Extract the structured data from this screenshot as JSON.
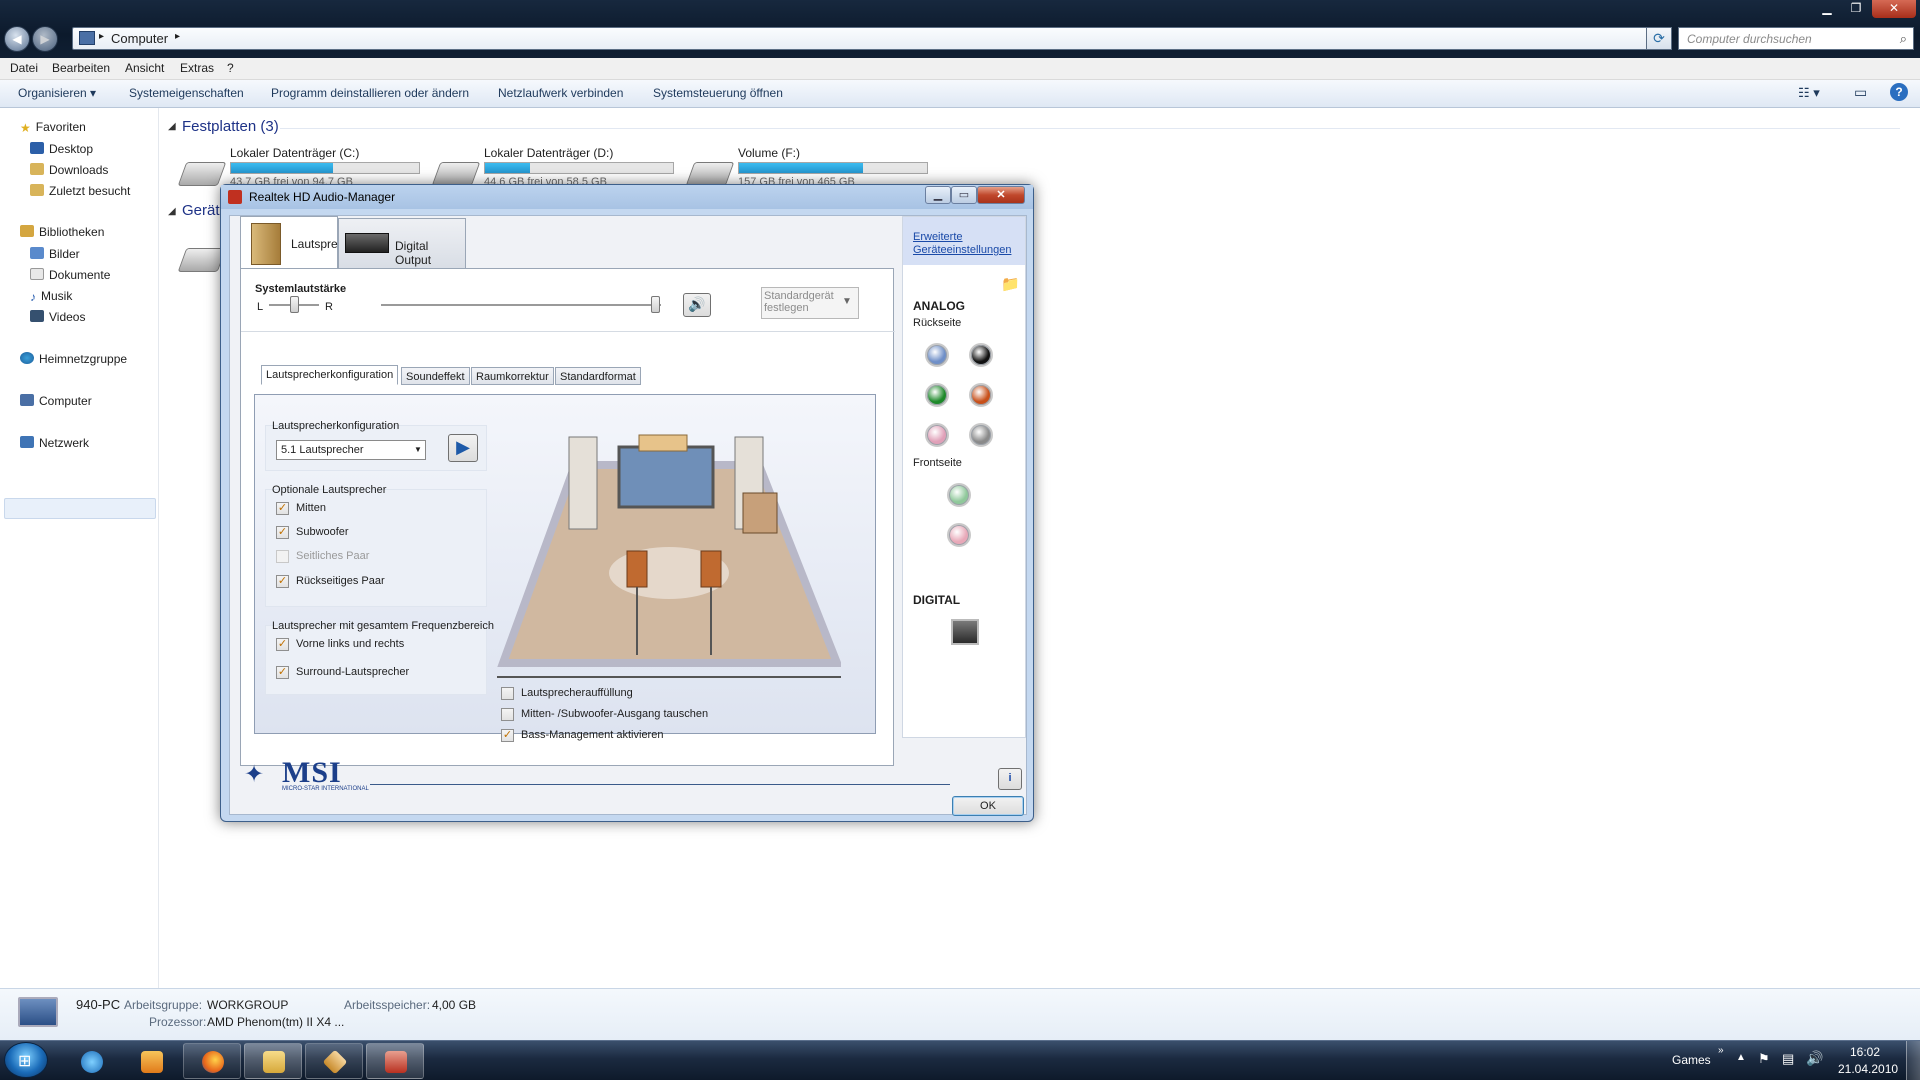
{
  "explorer": {
    "breadcrumb": "Computer",
    "search_placeholder": "Computer durchsuchen",
    "menu": [
      "Datei",
      "Bearbeiten",
      "Ansicht",
      "Extras",
      "?"
    ],
    "commands": [
      "Organisieren ▾",
      "Systemeigenschaften",
      "Programm deinstallieren oder ändern",
      "Netzlaufwerk verbinden",
      "Systemsteuerung öffnen"
    ],
    "nav": {
      "favorites": "Favoriten",
      "fav_items": [
        "Desktop",
        "Downloads",
        "Zuletzt besucht"
      ],
      "libraries": "Bibliotheken",
      "lib_items": [
        "Bilder",
        "Dokumente",
        "Musik",
        "Videos"
      ],
      "homegroup": "Heimnetzgruppe",
      "computer": "Computer",
      "network": "Netzwerk"
    },
    "group_disks": "Festplatten (3)",
    "group_devices": "Geräte",
    "drives": [
      {
        "name": "Lokaler Datenträger (C:)",
        "info": "43,7 GB frei von 94,7 GB",
        "used_fraction": 0.54
      },
      {
        "name": "Lokaler Datenträger (D:)",
        "info": "44,6 GB frei von 58,5 GB",
        "used_fraction": 0.24
      },
      {
        "name": "Volume (F:)",
        "info": "157 GB frei von 465 GB",
        "used_fraction": 0.66
      }
    ],
    "details": {
      "pc_name": "940-PC",
      "workgroup_label": "Arbeitsgruppe:",
      "workgroup": "WORKGROUP",
      "memory_label": "Arbeitsspeicher:",
      "memory": "4,00 GB",
      "cpu_label": "Prozessor:",
      "cpu": "AMD Phenom(tm) II X4 ..."
    }
  },
  "taskbar": {
    "toolbar": "Games",
    "time": "16:02",
    "date": "21.04.2010"
  },
  "dialog": {
    "title": "Realtek HD Audio-Manager",
    "tab_speakers": "Lautsprecher",
    "tab_digital": "Digital Output",
    "system_volume": "Systemlautstärke",
    "left": "L",
    "right": "R",
    "volume_fraction": 0.98,
    "balance_fraction": 0.5,
    "default_device_line1": "Standardgerät",
    "default_device_line2": "festlegen",
    "subtabs": [
      "Lautsprecherkonfiguration",
      "Soundeffekt",
      "Raumkorrektur",
      "Standardformat"
    ],
    "config_group": "Lautsprecherkonfiguration",
    "config_value": "5.1 Lautsprecher",
    "optional_group": "Optionale Lautsprecher",
    "optional": [
      {
        "label": "Mitten",
        "checked": true,
        "enabled": true
      },
      {
        "label": "Subwoofer",
        "checked": true,
        "enabled": true
      },
      {
        "label": "Seitliches Paar",
        "checked": false,
        "enabled": false
      },
      {
        "label": "Rückseitiges Paar",
        "checked": true,
        "enabled": true
      }
    ],
    "fullrange_group": "Lautsprecher mit gesamtem Frequenzbereich",
    "fullrange": [
      {
        "label": "Vorne links und rechts",
        "checked": true
      },
      {
        "label": "Surround-Lautsprecher",
        "checked": true
      }
    ],
    "bottom_options": [
      {
        "label": "Lautsprecherauffüllung",
        "checked": false
      },
      {
        "label": "Mitten- /Subwoofer-Ausgang tauschen",
        "checked": false
      },
      {
        "label": "Bass-Management aktivieren",
        "checked": true
      }
    ],
    "advanced_link_1": "Erweiterte",
    "advanced_link_2": "Geräteeinstellungen",
    "analog": "ANALOG",
    "rear": "Rückseite",
    "front": "Frontseite",
    "digital": "DIGITAL",
    "jack_colors": {
      "blue": "#6f8fc8",
      "black": "#111111",
      "green": "#1e8a2a",
      "orange": "#c8501a",
      "pink": "#e0a0b8",
      "gray": "#8a8a8a",
      "front_green": "#8fc89a",
      "front_pink": "#e8a8b8"
    },
    "brand": "MSI",
    "brand_sub": "MICRO-STAR INTERNATIONAL",
    "ok": "OK"
  }
}
